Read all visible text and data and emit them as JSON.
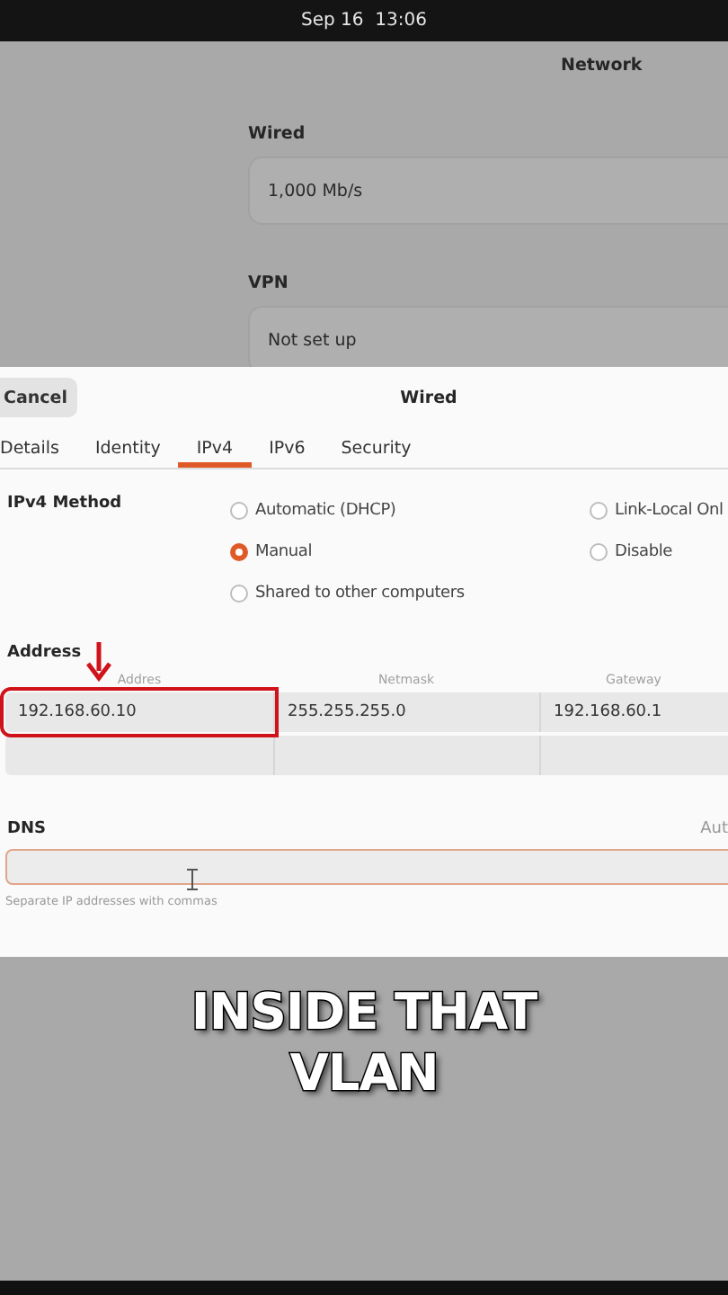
{
  "top_bar": {
    "clock": "Sep 16  13:06"
  },
  "network_page": {
    "title": "Network",
    "sections": [
      {
        "heading": "Wired",
        "value": "1,000 Mb/s"
      },
      {
        "heading": "VPN",
        "value": "Not set up"
      }
    ]
  },
  "dialog": {
    "cancel": "Cancel",
    "title": "Wired",
    "tabs": [
      {
        "label": "Details",
        "selected": false
      },
      {
        "label": "Identity",
        "selected": false
      },
      {
        "label": "IPv4",
        "selected": true
      },
      {
        "label": "IPv6",
        "selected": false
      },
      {
        "label": "Security",
        "selected": false
      }
    ],
    "method": {
      "label": "IPv4 Method",
      "options_left": [
        {
          "label": "Automatic (DHCP)",
          "selected": false
        },
        {
          "label": "Manual",
          "selected": true
        },
        {
          "label": "Shared to other computers",
          "selected": false
        }
      ],
      "options_right": [
        {
          "label": "Link-Local Onl",
          "selected": false
        },
        {
          "label": "Disable",
          "selected": false
        }
      ]
    },
    "addresses": {
      "heading": "Address",
      "columns": [
        "Addres",
        "Netmask",
        "Gateway"
      ],
      "rows": [
        {
          "cells": [
            "192.168.60.10",
            "255.255.255.0",
            "192.168.60.1"
          ],
          "highlighted": true
        }
      ]
    },
    "dns": {
      "label": "DNS",
      "automatic_label": "Aut",
      "focused": true,
      "hint": "Separate IP addresses with commas"
    }
  },
  "caption": "INSIDE THAT VLAN"
}
